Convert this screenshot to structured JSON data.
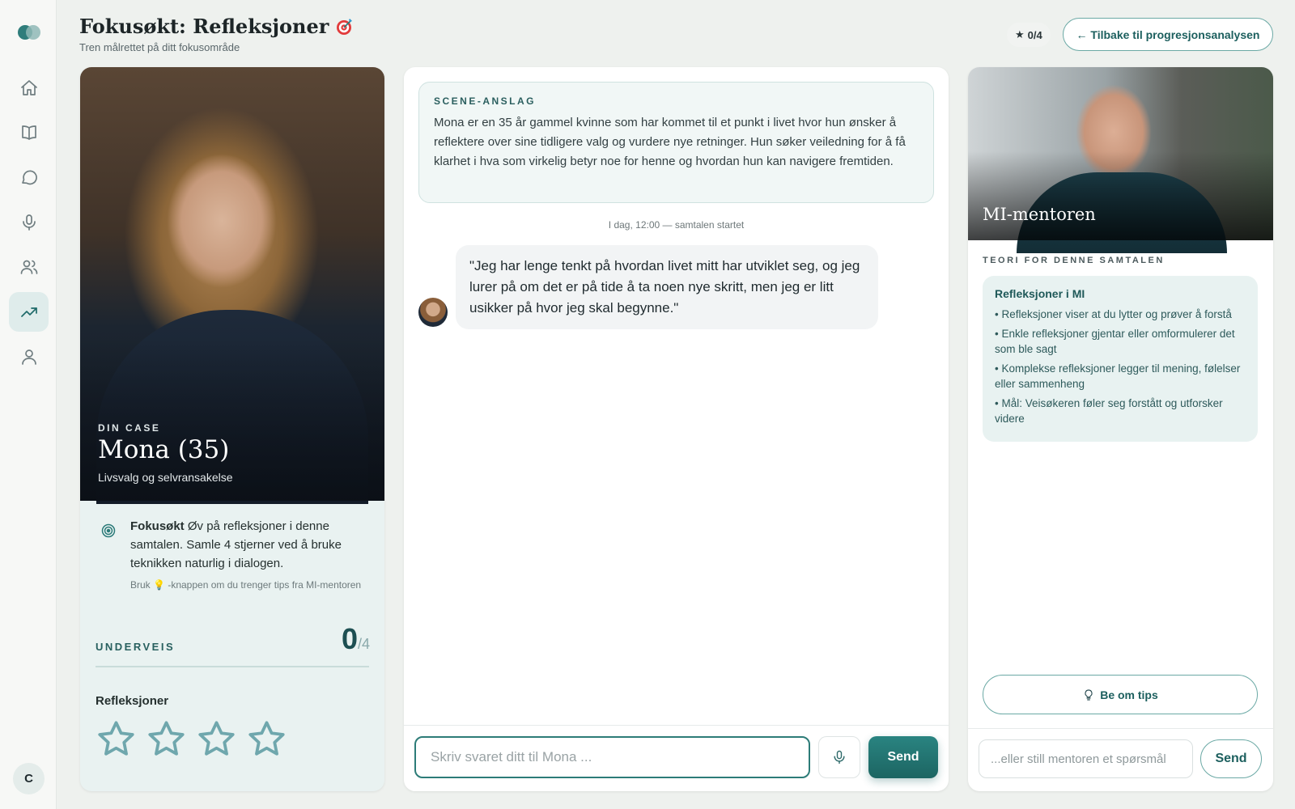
{
  "header": {
    "title": "Fokusøkt: Refleksjoner",
    "subtitle": "Tren målrettet på ditt fokusområde",
    "score": "0/4",
    "back_label": "← Tilbake til progresjonsanalysen"
  },
  "nav": {
    "items": [
      {
        "name": "home",
        "icon": "home-icon"
      },
      {
        "name": "library",
        "icon": "book-icon"
      },
      {
        "name": "chat",
        "icon": "chat-bubble-icon"
      },
      {
        "name": "voice",
        "icon": "microphone-icon"
      },
      {
        "name": "groups",
        "icon": "users-icon"
      },
      {
        "name": "progress",
        "icon": "trending-up-icon",
        "active": true
      },
      {
        "name": "profile",
        "icon": "user-icon"
      }
    ],
    "user_initial": "C"
  },
  "case": {
    "kicker": "DIN CASE",
    "name": "Mona (35)",
    "topic": "Livsvalg og selvransakelse",
    "focus_label": "Fokusøkt",
    "focus_text": "Øv på refleksjoner i denne samtalen. Samle 4 stjerner ved å bruke teknikken naturlig i dialogen.",
    "hint_prefix": "Bruk",
    "hint_suffix": "-knappen om du trenger tips fra MI-mentoren",
    "progress_label": "UNDERVEIS",
    "progress_value": "0",
    "progress_total": "/4",
    "skill_title": "Refleksjoner",
    "stars_earned": 0,
    "stars_total": 4
  },
  "chat": {
    "scene_kicker": "SCENE-ANSLAG",
    "scene_text": "Mona er en 35 år gammel kvinne som har kommet til et punkt i livet hvor hun ønsker å reflektere over sine tidligere valg og vurdere nye retninger. Hun søker veiledning for å få klarhet i hva som virkelig betyr noe for henne og hvordan hun kan navigere fremtiden.",
    "timestamp": "I dag, 12:00 — samtalen startet",
    "messages": [
      {
        "sender": "Mona",
        "text": "\"Jeg har lenge tenkt på hvordan livet mitt har utviklet seg, og jeg lurer på om det er på tide å ta noen nye skritt, men jeg er litt usikker på hvor jeg skal begynne.\""
      }
    ],
    "input_placeholder": "Skriv svaret ditt til Mona ...",
    "send_label": "Send"
  },
  "mentor": {
    "name": "MI-mentoren",
    "theory_kicker": "TEORI FOR DENNE SAMTALEN",
    "theory_title": "Refleksjoner i MI",
    "theory_items": [
      "• Refleksjoner viser at du lytter og prøver å forstå",
      "• Enkle refleksjoner gjentar eller omformulerer det som ble sagt",
      "• Komplekse refleksjoner legger til mening, følelser eller sammenheng",
      "• Mål: Veisøkeren føler seg forstått og utforsker videre"
    ],
    "tips_label": "Be om tips",
    "input_placeholder": "...eller still mentoren et spørsmål",
    "send_label": "Send"
  },
  "colors": {
    "accent": "#2a8481",
    "accent_dark": "#1c6562",
    "star_outline": "#6fa7ad",
    "panel_tint": "#e9f2f1"
  }
}
